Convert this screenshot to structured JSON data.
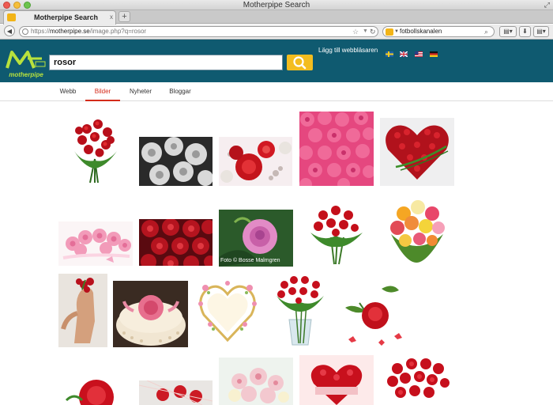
{
  "window": {
    "title": "Motherpipe Search"
  },
  "tab": {
    "title": "Motherpipe Search",
    "close": "x"
  },
  "toolbar": {
    "url_scheme": "https://",
    "url_domain": "motherpipe.se",
    "url_path": "/image.php?q=rosor",
    "search_engine_text": "fotbollskanalen"
  },
  "site": {
    "logo_text": "motherpipe",
    "query": "rosor",
    "add_browser": "Lägg till webbläsaren",
    "tabs": [
      {
        "label": "Webb"
      },
      {
        "label": "Bilder"
      },
      {
        "label": "Nyheter"
      },
      {
        "label": "Bloggar"
      }
    ],
    "active_tab": "Bilder",
    "thumbnail_caption": "Foto © Bosse Malmgren"
  },
  "colors": {
    "header": "#0f5a70",
    "accent_yellow": "#f3bd1f",
    "active_tab": "#d42b1a",
    "logo_green": "#b8e23d"
  }
}
